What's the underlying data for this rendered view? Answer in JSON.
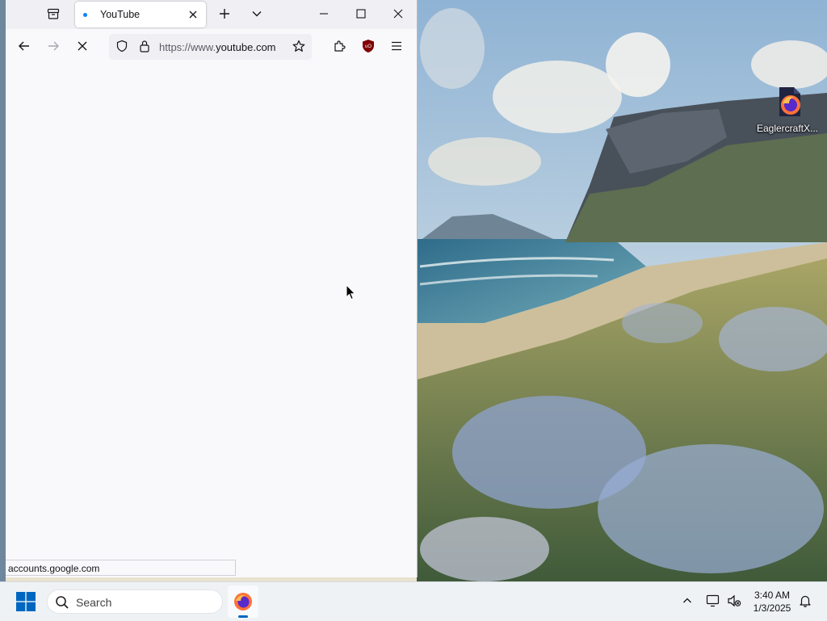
{
  "browser": {
    "tabs": [
      {
        "title": "YouTube",
        "close_label": "×"
      }
    ],
    "url": {
      "prefix": "https://www.",
      "domain": "youtube.com"
    },
    "status_text": "accounts.google.com",
    "loading": true
  },
  "desktop": {
    "icons": [
      {
        "label": "EaglercraftX...",
        "icon": "firefox-icon"
      }
    ]
  },
  "taskbar": {
    "search_placeholder": "Search",
    "pinned": [
      {
        "icon": "firefox-icon",
        "active": true
      }
    ],
    "clock": {
      "time": "3:40 AM",
      "date": "1/3/2025"
    }
  },
  "colors": {
    "accent": "#0a84ff",
    "windows_blue": "#0067c0",
    "ublock_red": "#800000"
  }
}
